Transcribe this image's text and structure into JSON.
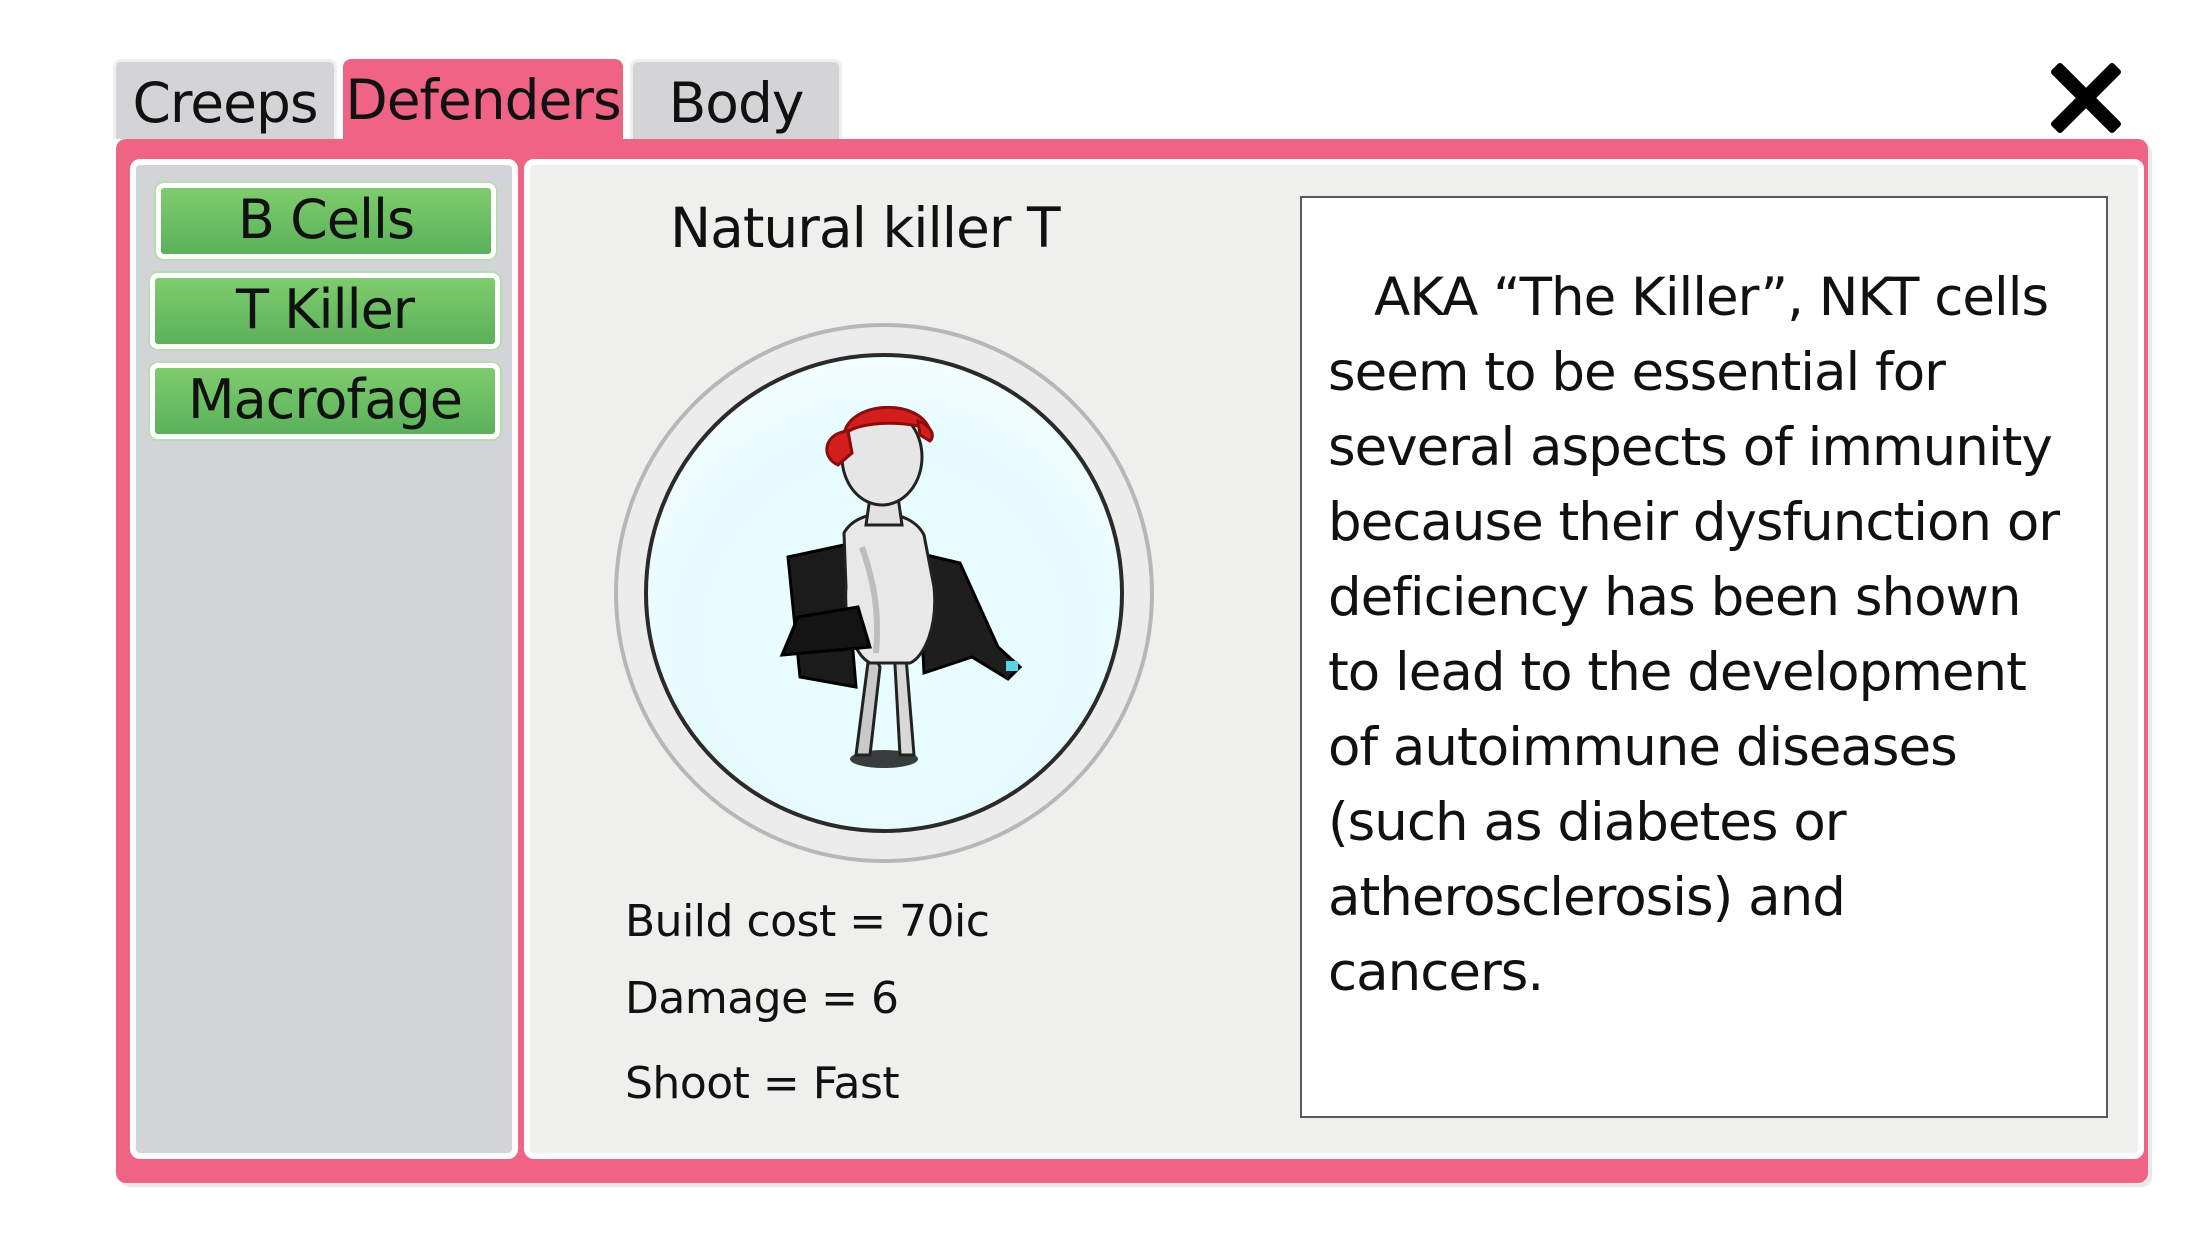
{
  "tabs": [
    {
      "label": "Creeps",
      "active": false
    },
    {
      "label": "Defenders",
      "active": true
    },
    {
      "label": "Body",
      "active": false
    }
  ],
  "close_icon": "close-x-icon",
  "sidebar": {
    "items": [
      {
        "label": "B Cells"
      },
      {
        "label": "T Killer"
      },
      {
        "label": "Macrofage"
      }
    ]
  },
  "detail": {
    "name": "Natural killer T",
    "portrait": "nkt-cell-character-icon",
    "stats": {
      "cost": "Build cost = 70ic",
      "damage": "Damage = 6",
      "shoot": "Shoot = Fast"
    },
    "description": "AKA “The Killer”, NKT cells seem to be essential for several aspects of immunity because their dysfunction or deficiency has been shown to lead to the development of autoimmune diseases (such as diabetes or atherosclerosis) and cancers."
  },
  "colors": {
    "accent_pink": "#ef6485",
    "button_green": "#6cbf62",
    "tab_inactive": "#d4d4d7",
    "panel_bg": "#efefee"
  }
}
